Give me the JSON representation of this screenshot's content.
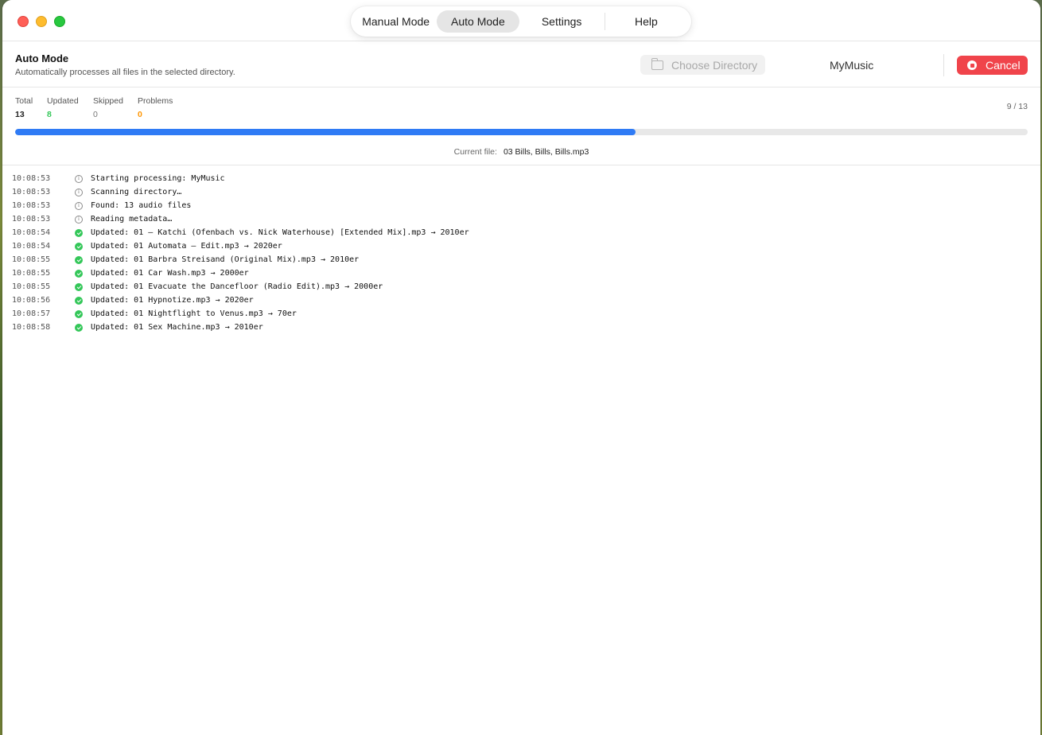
{
  "nav": {
    "tabs": [
      {
        "label": "Manual Mode"
      },
      {
        "label": "Auto Mode",
        "active": true
      },
      {
        "label": "Settings"
      },
      {
        "label": "Help"
      }
    ]
  },
  "header": {
    "title": "Auto Mode",
    "subtitle": "Automatically processes all files in the selected directory.",
    "choose_directory_label": "Choose Directory",
    "directory_name": "MyMusic",
    "cancel_label": "Cancel"
  },
  "stats": {
    "total_label": "Total",
    "total_value": "13",
    "updated_label": "Updated",
    "updated_value": "8",
    "skipped_label": "Skipped",
    "skipped_value": "0",
    "problems_label": "Problems",
    "problems_value": "0",
    "progress_text": "9 / 13",
    "progress_fraction": 0.613,
    "current_file_label": "Current file:",
    "current_file_value": "03 Bills, Bills, Bills.mp3"
  },
  "colors": {
    "accent_blue": "#2f7bf5",
    "success_green": "#34c759",
    "warning_orange": "#ff9500",
    "cancel_red": "#f0444b"
  },
  "log": [
    {
      "time": "10:08:53",
      "icon": "info-icon",
      "message": "Starting processing: MyMusic"
    },
    {
      "time": "10:08:53",
      "icon": "info-icon",
      "message": "Scanning directory…"
    },
    {
      "time": "10:08:53",
      "icon": "info-icon",
      "message": "Found: 13 audio files"
    },
    {
      "time": "10:08:53",
      "icon": "info-icon",
      "message": "Reading metadata…"
    },
    {
      "time": "10:08:54",
      "icon": "check-icon",
      "message": "Updated: 01 — Katchi (Ofenbach vs. Nick Waterhouse) [Extended Mix].mp3 → 2010er"
    },
    {
      "time": "10:08:54",
      "icon": "check-icon",
      "message": "Updated: 01 Automata — Edit.mp3 → 2020er"
    },
    {
      "time": "10:08:55",
      "icon": "check-icon",
      "message": "Updated: 01 Barbra Streisand (Original Mix).mp3 → 2010er"
    },
    {
      "time": "10:08:55",
      "icon": "check-icon",
      "message": "Updated: 01 Car Wash.mp3 → 2000er"
    },
    {
      "time": "10:08:55",
      "icon": "check-icon",
      "message": "Updated: 01 Evacuate the Dancefloor (Radio Edit).mp3 → 2000er"
    },
    {
      "time": "10:08:56",
      "icon": "check-icon",
      "message": "Updated: 01 Hypnotize.mp3 → 2020er"
    },
    {
      "time": "10:08:57",
      "icon": "check-icon",
      "message": "Updated: 01 Nightflight to Venus.mp3 → 70er"
    },
    {
      "time": "10:08:58",
      "icon": "check-icon",
      "message": "Updated: 01 Sex Machine.mp3 → 2010er"
    }
  ]
}
